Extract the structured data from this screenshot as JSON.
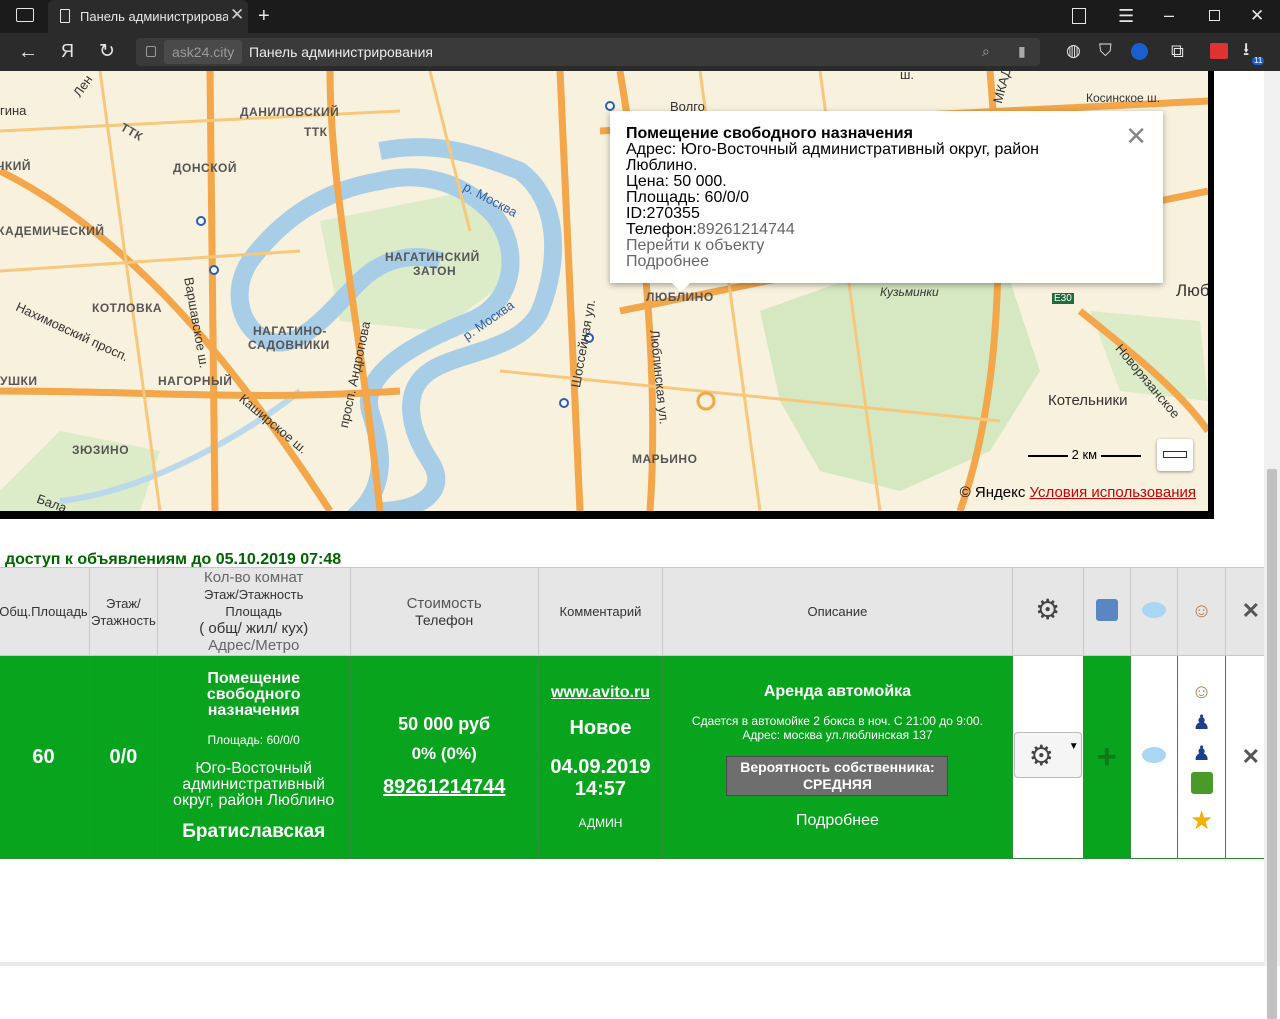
{
  "browser": {
    "tab_title": "Панель администрирования",
    "host": "ask24.city",
    "page_title": "Панель администрирования",
    "download_count": "11"
  },
  "map": {
    "districts": [
      "ДАНИЛОВСКИЙ",
      "ДОНСКОЙ",
      "АКАДЕМИЧЕСКИЙ",
      "КОТЛОВКА",
      "НАГАТИНО-",
      "САДОВНИКИ",
      "НАГАТИНСКИЙ",
      "ЗАТОН",
      "НАГОРНЫЙ",
      "ЗЮЗИНО",
      "ЛЮБЛИНО",
      "МАРЬИНО",
      "ЧКИЙ",
      "УШКИ",
      "ТТК",
      "ТТК"
    ],
    "roads": [
      "Варшавское ш.",
      "Каширское ш.",
      "просп. Андропова",
      "Шоссейная ул.",
      "Люблинская ул.",
      "Нахимовский просп.",
      "Косинское ш.",
      "Новорязанское",
      "Кузьминки",
      "Котельники",
      "Волго",
      "E30",
      "МКАД",
      "Люб",
      "Лен",
      "гина",
      "Бала",
      "ш."
    ],
    "river": [
      "р. Москва",
      "р. Москва"
    ],
    "scale_label": "2 км",
    "attribution": "© Яндекс",
    "terms_link": "Условия использования",
    "popup": {
      "title": "Помещение свободного назначения",
      "address": "Адрес: Юго-Восточный административный округ, район Люблино.",
      "price": "Цена: 50 000.",
      "area": "Площадь: 60/0/0",
      "id": "ID:270355",
      "phone_label": "Телефон:",
      "phone": "89261214744",
      "goto": "Перейти к объекту",
      "more": "Подробнее"
    }
  },
  "listing": {
    "access_text": "доступ к объявлениям до 05.10.2019 07:48",
    "headers": {
      "area": "Общ.Площадь",
      "floor_1": "Этаж/",
      "floor_2": "Этажность",
      "rooms_1": "Кол-во комнат",
      "rooms_2": "Этаж/Этажность",
      "rooms_3": "Площадь",
      "rooms_4": "( общ/ жил/ кух)",
      "rooms_5": "Адрес/Метро",
      "price_1": "Стоимость",
      "price_2": "Телефон",
      "comment": "Комментарий",
      "description": "Описание"
    },
    "row": {
      "area": "60",
      "floor": "0/0",
      "object_type": "Помещение свободного назначения",
      "area_detail": "Площадь: 60/0/0",
      "address": "Юго-Восточный административный округ, район Люблино",
      "metro": "Братиславская",
      "price": "50 000 руб",
      "percent": "0% (0%)",
      "phone": "89261214744",
      "source": "www.avito.ru",
      "status": "Новое",
      "date": "04.09.2019",
      "time": "14:57",
      "author": "АДМИН",
      "desc_title": "Аренда автомойка",
      "desc_text_1": "Сдается в автомойке 2 бокса в ноч. С 21:00 до 9:00.",
      "desc_text_2": "Адрес: москва ул.люблинская 137",
      "probability": "Вероятность собственника: СРЕДНЯЯ",
      "more": "Подробнее",
      "plus": "+"
    }
  },
  "colors": {
    "row_green": "#08a41e",
    "access_green": "#006400",
    "header_gray": "#e6e6e6"
  }
}
